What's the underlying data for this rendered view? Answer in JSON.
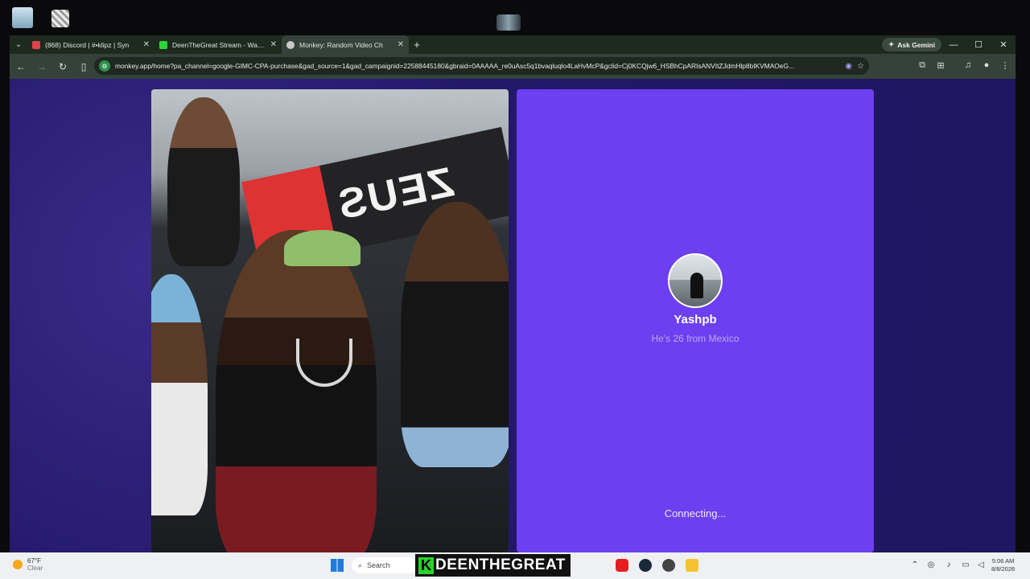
{
  "browser": {
    "tabs": [
      {
        "title": "(868) Discord | #•klipz | Syn",
        "active": false,
        "favicon_color": "#e0424a"
      },
      {
        "title": "DeenTheGreat Stream - Watch",
        "active": false,
        "favicon_color": "#29d63a"
      },
      {
        "title": "Monkey: Random Video Ch",
        "active": true,
        "favicon_color": "#c9c9c9"
      }
    ],
    "new_tab_symbol": "+",
    "ask_gemini_label": "Ask Gemini",
    "url": "monkey.app/home?pa_channel=google-GIMC-CPA-purchase&gad_source=1&gad_campaignid=22588445180&gbraid=0AAAAA_re0uAsc5q1bvaqluqlo4LaHvMcP&gclid=Cj0KCQjw6_HSBhCpARIsANVItZJdmHlp8bIKVMAOeG..."
  },
  "call": {
    "username": "Yashpb",
    "subtitle": "He's 26 from Mexico",
    "status": "Connecting...",
    "panel_color": "#6c3ff0"
  },
  "video": {
    "banner_text": "ZEUS"
  },
  "taskbar": {
    "weather_temp": "67°F",
    "weather_desc": "Clear",
    "search_label": "Search",
    "brand_k": "K",
    "brand_name": "DEENTHEGREAT",
    "time": "5:06 AM",
    "date": "8/8/2026"
  }
}
